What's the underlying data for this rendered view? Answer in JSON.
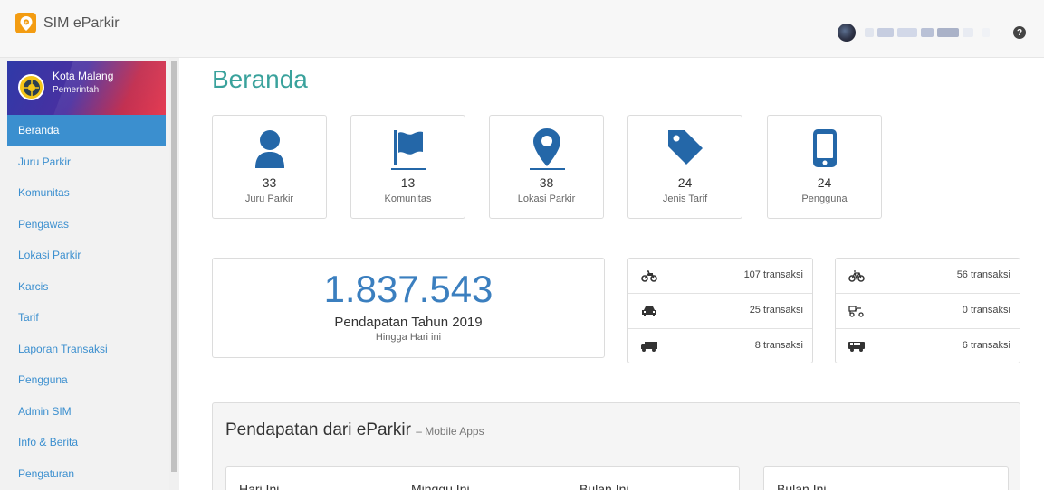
{
  "app": {
    "title": "SIM eParkir"
  },
  "org": {
    "name": "Kota Malang",
    "subtitle": "Pemerintah"
  },
  "nav": [
    {
      "label": "Beranda",
      "active": true
    },
    {
      "label": "Juru Parkir"
    },
    {
      "label": "Komunitas"
    },
    {
      "label": "Pengawas"
    },
    {
      "label": "Lokasi Parkir"
    },
    {
      "label": "Karcis"
    },
    {
      "label": "Tarif"
    },
    {
      "label": "Laporan Transaksi"
    },
    {
      "label": "Pengguna"
    },
    {
      "label": "Admin SIM"
    },
    {
      "label": "Info & Berita"
    },
    {
      "label": "Pengaturan"
    }
  ],
  "page": {
    "title": "Beranda"
  },
  "stats": [
    {
      "icon": "user-icon",
      "value": "33",
      "label": "Juru Parkir"
    },
    {
      "icon": "flag-icon",
      "value": "13",
      "label": "Komunitas"
    },
    {
      "icon": "map-marker-icon",
      "value": "38",
      "label": "Lokasi Parkir"
    },
    {
      "icon": "tag-icon",
      "value": "24",
      "label": "Jenis Tarif"
    },
    {
      "icon": "mobile-icon",
      "value": "24",
      "label": "Pengguna"
    }
  ],
  "revenue": {
    "value": "1.837.543",
    "title": "Pendapatan Tahun 2019",
    "subtitle": "Hingga Hari ini"
  },
  "transactions_left": [
    {
      "icon": "motorcycle-icon",
      "text": "107 transaksi"
    },
    {
      "icon": "car-icon",
      "text": "25 transaksi"
    },
    {
      "icon": "truck-icon",
      "text": "8 transaksi"
    }
  ],
  "transactions_right": [
    {
      "icon": "bicycle-icon",
      "text": "56 transaksi"
    },
    {
      "icon": "pedicab-icon",
      "text": "0 transaksi"
    },
    {
      "icon": "bus-icon",
      "text": "6 transaksi"
    }
  ],
  "panel": {
    "title": "Pendapatan dari eParkir",
    "subtitle": "– Mobile Apps",
    "col1": "Hari Ini",
    "col2": "Minggu Ini",
    "col3": "Bulan Ini",
    "col4": "Bulan Ini"
  },
  "colors": {
    "accent": "#3b8fcf",
    "title": "#3aa29c",
    "brand": "#f39c12"
  }
}
